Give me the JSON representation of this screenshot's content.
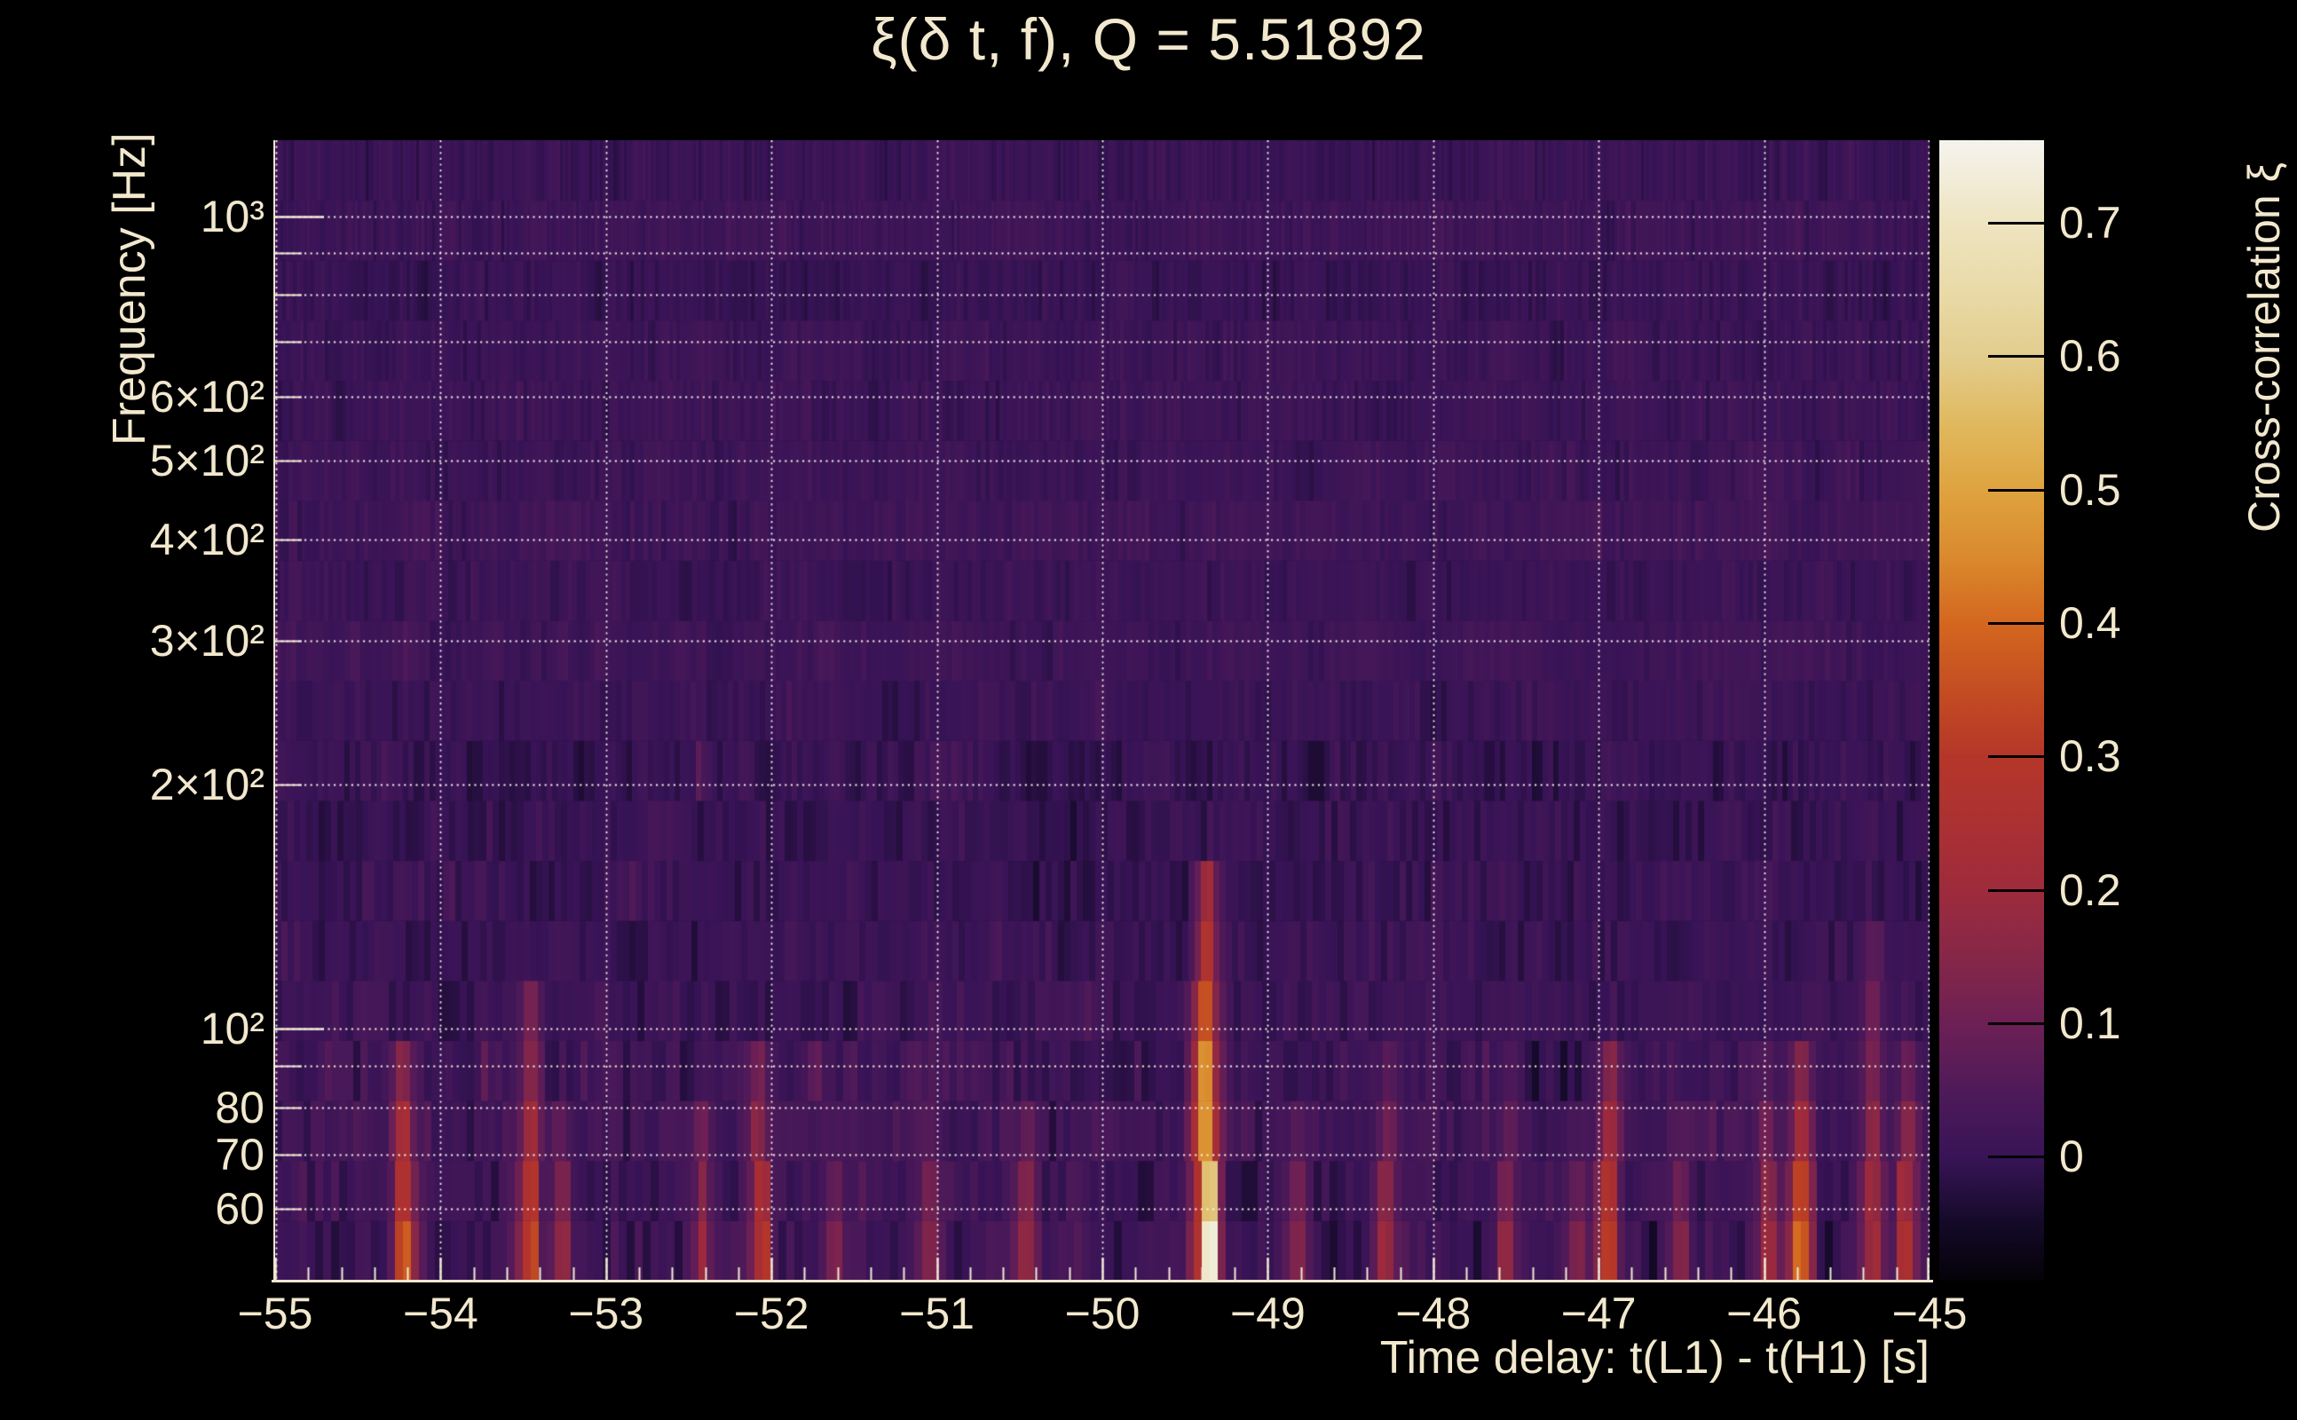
{
  "header": {
    "title": "ξ(δ t, f), Q = 5.51892"
  },
  "colors": {
    "background": "#000000",
    "text": "#f2e8cd",
    "axis_line": "#efe7d0",
    "grid": "#fbf7ee",
    "colorbar_tick": "#000000"
  },
  "axes": {
    "x": {
      "title": "Time delay: t(L1) - t(H1) [s]",
      "ticks": [
        {
          "v": -55,
          "label": "−55"
        },
        {
          "v": -54,
          "label": "−54"
        },
        {
          "v": -53,
          "label": "−53"
        },
        {
          "v": -52,
          "label": "−52"
        },
        {
          "v": -51,
          "label": "−51"
        },
        {
          "v": -50,
          "label": "−50"
        },
        {
          "v": -49,
          "label": "−49"
        },
        {
          "v": -48,
          "label": "−48"
        },
        {
          "v": -47,
          "label": "−47"
        },
        {
          "v": -46,
          "label": "−46"
        },
        {
          "v": -45,
          "label": "−45"
        }
      ]
    },
    "y": {
      "title": "Frequency [Hz]",
      "ticks": [
        {
          "v": 1000,
          "label": "10³"
        },
        {
          "v": 600,
          "label": "6×10²"
        },
        {
          "v": 500,
          "label": "5×10²"
        },
        {
          "v": 400,
          "label": "4×10²"
        },
        {
          "v": 300,
          "label": "3×10²"
        },
        {
          "v": 200,
          "label": "2×10²"
        },
        {
          "v": 100,
          "label": "10²"
        },
        {
          "v": 80,
          "label": "80"
        },
        {
          "v": 70,
          "label": "70"
        },
        {
          "v": 60,
          "label": "60"
        }
      ]
    },
    "z": {
      "title": "Cross-correlation ξ",
      "ticks": [
        {
          "v": 0.7,
          "label": "0.7"
        },
        {
          "v": 0.6,
          "label": "0.6"
        },
        {
          "v": 0.5,
          "label": "0.5"
        },
        {
          "v": 0.4,
          "label": "0.4"
        },
        {
          "v": 0.3,
          "label": "0.3"
        },
        {
          "v": 0.2,
          "label": "0.2"
        },
        {
          "v": 0.1,
          "label": "0.1"
        },
        {
          "v": 0.0,
          "label": "0"
        }
      ]
    }
  },
  "chart_data": {
    "type": "heatmap",
    "title": "ξ(δ t, f), Q = 5.51892",
    "xlabel": "Time delay: t(L1) - t(H1) [s]",
    "ylabel": "Frequency [Hz]",
    "zlabel": "Cross-correlation ξ",
    "q_value": 5.51892,
    "x_range": [
      -55,
      -45
    ],
    "y_range": [
      49,
      1240
    ],
    "y_scale": "log",
    "z_range": [
      -0.093,
      0.762
    ],
    "grid": {
      "x_lines": [
        -54,
        -53,
        -52,
        -51,
        -50,
        -49,
        -48,
        -47,
        -46,
        -45
      ],
      "y_lines": [
        60,
        70,
        80,
        90,
        100,
        200,
        300,
        400,
        500,
        600,
        700,
        800,
        900,
        1000
      ],
      "style": "dotted-white"
    },
    "x_minor_tick_step": 0.2,
    "colormap_stops": [
      {
        "v": -0.093,
        "c": "#050208"
      },
      {
        "v": -0.05,
        "c": "#140a28"
      },
      {
        "v": 0.0,
        "c": "#381457"
      },
      {
        "v": 0.05,
        "c": "#4f1a59"
      },
      {
        "v": 0.1,
        "c": "#6d2055"
      },
      {
        "v": 0.15,
        "c": "#862748"
      },
      {
        "v": 0.2,
        "c": "#9e2b3c"
      },
      {
        "v": 0.25,
        "c": "#ab3132"
      },
      {
        "v": 0.3,
        "c": "#b53629"
      },
      {
        "v": 0.35,
        "c": "#c44d22"
      },
      {
        "v": 0.4,
        "c": "#d4671f"
      },
      {
        "v": 0.45,
        "c": "#da8a2e"
      },
      {
        "v": 0.5,
        "c": "#dfa33f"
      },
      {
        "v": 0.55,
        "c": "#e0b95f"
      },
      {
        "v": 0.6,
        "c": "#e3cd8e"
      },
      {
        "v": 0.65,
        "c": "#e9daa8"
      },
      {
        "v": 0.7,
        "c": "#eee4c0"
      },
      {
        "v": 0.762,
        "c": "#f5f3ee"
      }
    ],
    "noise_model": {
      "seed": 1337,
      "n_rows": 19,
      "base_value": 0.008,
      "sigma_low_freq": 0.052,
      "sigma_mid_freq": 0.04,
      "sigma_high_freq": 0.028,
      "low_freq_cutoff_hz": 95,
      "mid_freq_cutoff_hz": 210
    },
    "hotspots": [
      {
        "t": -54.21,
        "f_top": 100,
        "peak": 0.4
      },
      {
        "t": -53.47,
        "f_top": 115,
        "peak": 0.34
      },
      {
        "t": -53.28,
        "f_top": 85,
        "peak": 0.2
      },
      {
        "t": -52.42,
        "f_top": 88,
        "peak": 0.22
      },
      {
        "t": -52.07,
        "f_top": 100,
        "peak": 0.3
      },
      {
        "t": -51.62,
        "f_top": 75,
        "peak": 0.15
      },
      {
        "t": -51.05,
        "f_top": 82,
        "peak": 0.18
      },
      {
        "t": -50.47,
        "f_top": 82,
        "peak": 0.22
      },
      {
        "t": -49.37,
        "f_top": 160,
        "peak": 0.7
      },
      {
        "t": -48.83,
        "f_top": 80,
        "peak": 0.17
      },
      {
        "t": -48.28,
        "f_top": 95,
        "peak": 0.2
      },
      {
        "t": -47.55,
        "f_top": 90,
        "peak": 0.18
      },
      {
        "t": -47.15,
        "f_top": 75,
        "peak": 0.15
      },
      {
        "t": -46.95,
        "f_top": 105,
        "peak": 0.36
      },
      {
        "t": -46.52,
        "f_top": 80,
        "peak": 0.16
      },
      {
        "t": -45.98,
        "f_top": 90,
        "peak": 0.22
      },
      {
        "t": -45.79,
        "f_top": 100,
        "peak": 0.42
      },
      {
        "t": -45.35,
        "f_top": 140,
        "peak": 0.22
      },
      {
        "t": -45.13,
        "f_top": 95,
        "peak": 0.3
      }
    ]
  }
}
